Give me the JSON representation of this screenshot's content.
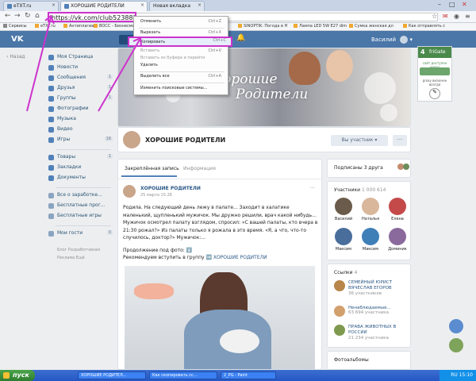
{
  "browser": {
    "tabs": [
      {
        "label": "eTXT.ru",
        "active": false
      },
      {
        "label": "ХОРОШИЕ РОДИТЕЛИ",
        "active": true
      },
      {
        "label": "Новая вкладка",
        "active": false
      }
    ],
    "url": "https://vk.com/club52388302",
    "bookmarks": [
      "Сервисы",
      "eTXT.ru",
      "Антиплагиат",
      "ВОСС - Бизнесменам",
      "SINOPTIK: Погода в Н",
      "Лампа LED 5W E27 dim",
      "Сумка женская дл",
      "Как отправлять с"
    ]
  },
  "context_menu": {
    "items": [
      {
        "label": "Отменить",
        "shortcut": "Ctrl+Z",
        "disabled": false,
        "highlighted": false
      },
      {
        "label": "Вырезать",
        "shortcut": "Ctrl+X",
        "disabled": false,
        "highlighted": false
      },
      {
        "label": "Копировать",
        "shortcut": "Ctrl+C",
        "disabled": false,
        "highlighted": true
      },
      {
        "label": "Вставить",
        "shortcut": "Ctrl+V",
        "disabled": true,
        "highlighted": false
      },
      {
        "label": "Вставить из буфера и перейти",
        "shortcut": "",
        "disabled": true,
        "highlighted": false
      },
      {
        "label": "Удалить",
        "shortcut": "",
        "disabled": false,
        "highlighted": false
      },
      {
        "label": "Выделить все",
        "shortcut": "Ctrl+A",
        "disabled": false,
        "highlighted": false
      },
      {
        "label": "Изменить поисковые системы...",
        "shortcut": "",
        "disabled": false,
        "highlighted": false
      }
    ]
  },
  "vk_header": {
    "logo": "VK",
    "user_name": "Василий"
  },
  "left_nav": {
    "back": "Назад",
    "items": [
      {
        "label": "Моя Страница",
        "count": ""
      },
      {
        "label": "Новости",
        "count": ""
      },
      {
        "label": "Сообщения",
        "count": "1"
      },
      {
        "label": "Друзья",
        "count": "1"
      },
      {
        "label": "Группы",
        "count": "1"
      },
      {
        "label": "Фотографии",
        "count": ""
      },
      {
        "label": "Музыка",
        "count": ""
      },
      {
        "label": "Видео",
        "count": ""
      },
      {
        "label": "Игры",
        "count": "16"
      }
    ],
    "items2": [
      {
        "label": "Товары",
        "count": "1"
      },
      {
        "label": "Закладки",
        "count": ""
      },
      {
        "label": "Документы",
        "count": ""
      }
    ],
    "items3": [
      {
        "label": "Все о заработке...",
        "count": ""
      },
      {
        "label": "Бесплатные прог...",
        "count": ""
      },
      {
        "label": "Бесплатные игры",
        "count": ""
      }
    ],
    "items4": [
      {
        "label": "Мои гости",
        "count": "0"
      }
    ],
    "footer1": "Блог  Разработчикам",
    "footer2": "Реклама  Ещё"
  },
  "cover": {
    "title_line1": "Хорошие",
    "title_line2": "Родители"
  },
  "group": {
    "name": "ХОРОШИЕ РОДИТЕЛИ",
    "subscribe_label": "Вы участник",
    "more_label": "···"
  },
  "feed": {
    "tab_pinned": "Закреплённая запись",
    "tab_info": "Информация",
    "post_author": "ХОРОШИЕ РОДИТЕЛИ",
    "post_date": "25 марта 15:26",
    "post_text": "Родила. На следующий день лежу в палате... Заходит в халатике маленький, щупленький мужичок. Мы дружно решили, врач какой нибудь... Мужичок осмотрел палату взглядом, спросил: «С вашей палаты, кто вчера в 21:30 рожал?» Из палаты только я рожала в это время. «Я, а что, что-то случилось, доктор?» Мужичок:...",
    "post_more": "Продолжение под фото: ⬇️",
    "post_recommend_prefix": "Рекомендуем вступить в группу ➡️ ",
    "post_recommend_link": "ХОРОШИЕ РОДИТЕЛИ"
  },
  "right": {
    "subs_title": "Подписаны 3 друга",
    "members_title": "Участники",
    "members_count": "1 000 614",
    "members": [
      "Василий",
      "Наталья",
      "Елена",
      "Максим",
      "Максим",
      "Доминик"
    ],
    "links_title": "Ссылки",
    "links_count": "4",
    "links": [
      {
        "name": "СЕМЕЙНЫЙ ЮРИСТ ВЯЧЕСЛАВ ЕГОРОВ",
        "count": "36 участников"
      },
      {
        "name": "Ненаблюдаемые...",
        "count": "63 694 участника"
      },
      {
        "name": "ПРАВА ЖИВОТНЫХ В РОССИИ",
        "count": "21 234 участника"
      }
    ],
    "photo_albums": "Фотоальбомы"
  },
  "frigate": {
    "title": "friGate",
    "line1": "сайт доступен через",
    "line2": "proxy включен всегда"
  },
  "taskbar": {
    "start": "пуск",
    "buttons": [
      "ХОРОШИЕ РОДИТЕЛ...",
      "Как скопировать сс...",
      "2_PG - Paint"
    ],
    "lang": "RU",
    "time": "15:10"
  },
  "colors": {
    "vk_blue": "#4a76a8",
    "highlight": "#cc33cc",
    "link": "#2a5885"
  }
}
